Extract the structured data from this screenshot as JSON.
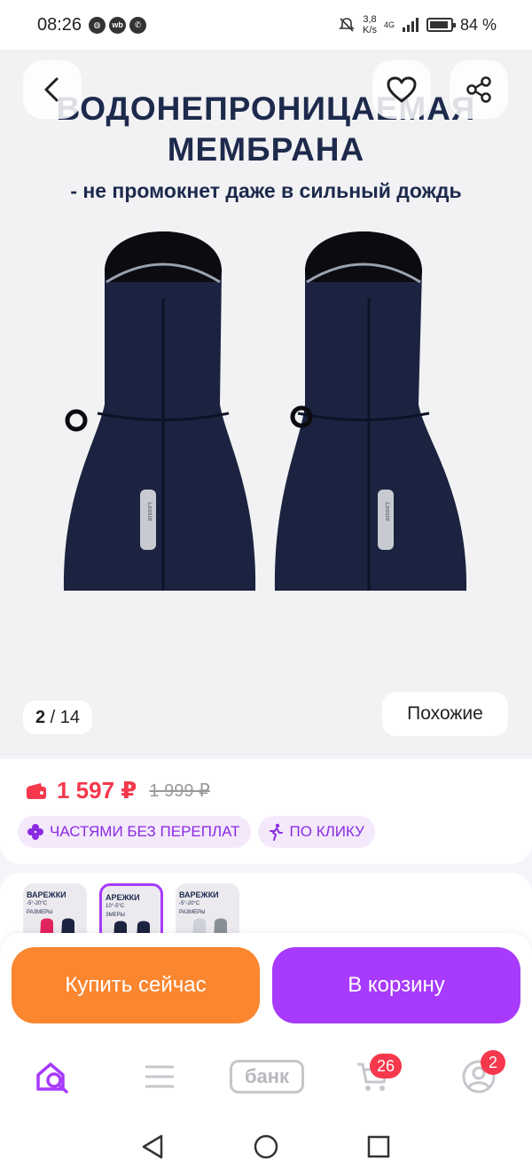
{
  "status_bar": {
    "time": "08:26",
    "speed": "3,8\nK/s",
    "network": "4G",
    "battery": "84 %"
  },
  "gallery": {
    "headline_line1": "ВОДОНЕПРОНИЦАЕМАЯ",
    "headline_line2": "МЕМБРАНА",
    "subline": "- не промокнет даже в сильный дождь",
    "brand_tag": "Lassie",
    "counter_current": "2",
    "counter_sep": " / ",
    "counter_total": "14",
    "similar_label": "Похожие"
  },
  "price": {
    "current": "1 597 ₽",
    "old": "1 999 ₽",
    "chips": [
      {
        "label": "ЧАСТЯМИ БЕЗ ПЕРЕПЛАТ",
        "icon": "clover-icon"
      },
      {
        "label": "ПО КЛИКУ",
        "icon": "running-person-icon"
      }
    ]
  },
  "thumbnails": [
    {
      "title": "ВАРЕЖКИ",
      "temp": "-5°-20°C",
      "sizes": "РАЗМЕРЫ",
      "colors": [
        "#e0245e",
        "#1b2340"
      ],
      "selected": false
    },
    {
      "title": "АРЕЖКИ",
      "temp": "10°-5°C",
      "sizes": "ЗМЕРЫ",
      "colors": [
        "#1b2340",
        "#1b2340"
      ],
      "selected": true
    },
    {
      "title": "ВАРЕЖКИ",
      "temp": "-5°-20°C",
      "sizes": "РАЗМЕРЫ",
      "colors": [
        "#cfd2d8",
        "#8a9098"
      ],
      "selected": false
    }
  ],
  "actions": {
    "buy_now": "Купить сейчас",
    "add_to_cart": "В корзину"
  },
  "bottom_nav": {
    "bank_label": "банк",
    "cart_badge": "26",
    "profile_badge": "2"
  },
  "colors": {
    "accent_purple": "#a73afd",
    "accent_orange": "#fb8630",
    "price_red": "#f5384c",
    "navy": "#1d2a4c"
  }
}
